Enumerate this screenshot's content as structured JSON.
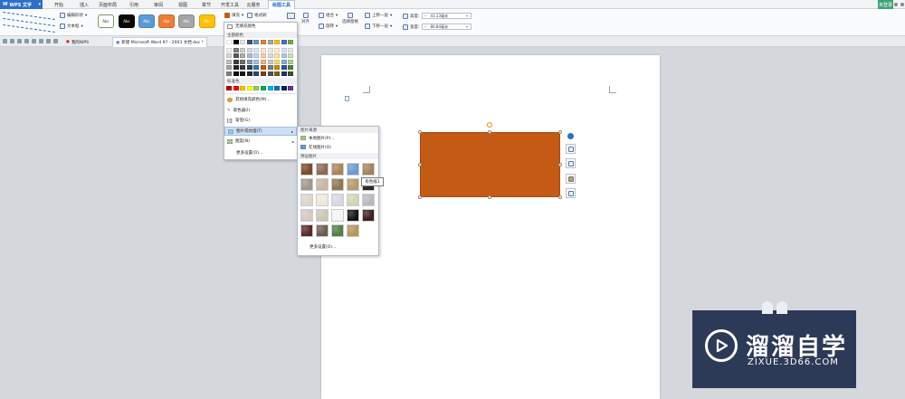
{
  "app": {
    "name": "WPS 文字",
    "dropdown": "▾"
  },
  "tabs": [
    {
      "label": "开始"
    },
    {
      "label": "插入"
    },
    {
      "label": "页面布局"
    },
    {
      "label": "引用"
    },
    {
      "label": "审阅"
    },
    {
      "label": "视图"
    },
    {
      "label": "章节"
    },
    {
      "label": "开发工具"
    },
    {
      "label": "云服务"
    },
    {
      "label": "绘图工具"
    }
  ],
  "active_tab": "绘图工具",
  "login_label": "未登录",
  "ribbon": {
    "edit_shape": "编辑形状",
    "text_box": "文本框",
    "style_swatches": [
      {
        "label": "Abc",
        "color": "#ffffff",
        "text_color": "#333333"
      },
      {
        "label": "Abc",
        "color": "#0a0a0a",
        "text_color": "#ffffff"
      },
      {
        "label": "Abc",
        "color": "#5b9bd5",
        "text_color": "#ffffff"
      },
      {
        "label": "Abc",
        "color": "#ed7d31",
        "text_color": "#ffffff"
      },
      {
        "label": "Abc",
        "color": "#a5a5a5",
        "text_color": "#ffffff"
      },
      {
        "label": "Abc",
        "color": "#ffc000",
        "text_color": "#ffffff"
      }
    ],
    "fill": "填充",
    "format_brush": "格式刷",
    "align": "对齐",
    "group": "组合",
    "rotate": "旋转",
    "selection_pane": "选择窗格",
    "bring_forward": "上移一层",
    "send_backward": "下移一层",
    "height_label": "高度:",
    "height_value": "41.13毫米",
    "width_label": "宽度:",
    "width_value": "86.84毫米",
    "minus": "−",
    "plus": "+"
  },
  "doc_tabs": [
    {
      "label": "我的WPS"
    },
    {
      "label": "新建 Microsoft Word 97 - 2003 文档.doc *"
    }
  ],
  "fill_menu": {
    "no_fill": "无填充颜色",
    "theme_colors_title": "主题颜色",
    "standard_colors_title": "标准色",
    "more_colors": "其他填充颜色(M)...",
    "eyedropper": "取色器(I)",
    "gradient": "渐变(G)",
    "picture_texture": "图片或纹理(T)",
    "pattern": "图案(N)",
    "more_settings": "更多设置(O)...",
    "arrow": "▸"
  },
  "theme_top_row": [
    "#ffffff",
    "#000000",
    "#e7e6e6",
    "#44546a",
    "#5b9bd5",
    "#ed7d31",
    "#a5a5a5",
    "#ffc000",
    "#4472c4",
    "#70ad47"
  ],
  "theme_shades": [
    [
      "#f2f2f2",
      "#7f7f7f",
      "#d0cece",
      "#d6dce4",
      "#deebf6",
      "#fbe5d5",
      "#ededed",
      "#fff2cc",
      "#dae3f3",
      "#e2efd9"
    ],
    [
      "#d8d8d8",
      "#595959",
      "#aeaaaa",
      "#adb9ca",
      "#bdd7ee",
      "#f8cbad",
      "#dbdbdb",
      "#fee599",
      "#b4c6e7",
      "#c5e0b3"
    ],
    [
      "#bfbfbf",
      "#3f3f3f",
      "#757070",
      "#8496b0",
      "#9dc3e6",
      "#f4b183",
      "#c9c9c9",
      "#ffd965",
      "#8eaadb",
      "#a8d08d"
    ],
    [
      "#a5a5a5",
      "#262626",
      "#3a3838",
      "#323f4f",
      "#2e75b5",
      "#c55a11",
      "#7b7b7b",
      "#bf9000",
      "#2f5496",
      "#538135"
    ],
    [
      "#7f7f7f",
      "#0c0c0c",
      "#171616",
      "#222a35",
      "#1e4e79",
      "#833c0b",
      "#525252",
      "#7f6000",
      "#1f3864",
      "#375623"
    ]
  ],
  "standard_colors": [
    "#c00000",
    "#ff0000",
    "#ffc000",
    "#ffff00",
    "#92d050",
    "#00b050",
    "#00b0f0",
    "#0070c0",
    "#002060",
    "#7030a0"
  ],
  "picture_submenu": {
    "source_title": "图片来源",
    "local_picture": "本地图片(P)...",
    "online_picture": "在线图片(O)",
    "preset_title": "预设图片",
    "more_settings": "更多设置(O)...",
    "tooltip": "有色纸1"
  },
  "textures": [
    [
      "#7a4b2a",
      "#8a6a52",
      "#a88656",
      "#6a9bd0",
      "#a3825c"
    ],
    [
      "#a1968a",
      "#c7b4a3",
      "#8f7650",
      "#b59a6b",
      "#2e2620"
    ],
    [
      "#ddd5cc",
      "#eee7dd",
      "#d7d7df",
      "#cfd7b6",
      "#b9b9bd"
    ],
    [
      "#d9c5c5",
      "#cbc6b8",
      "#f4f4f4",
      "#141414",
      "#3b2020"
    ],
    [
      "#5a2a2a",
      "#6e5a52",
      "#4f7f44",
      "#b89460"
    ]
  ],
  "shape": {
    "fill_color": "#c35b14"
  },
  "watermark": {
    "title": "溜溜自学",
    "url": "ZIXUE.3D66.COM"
  }
}
